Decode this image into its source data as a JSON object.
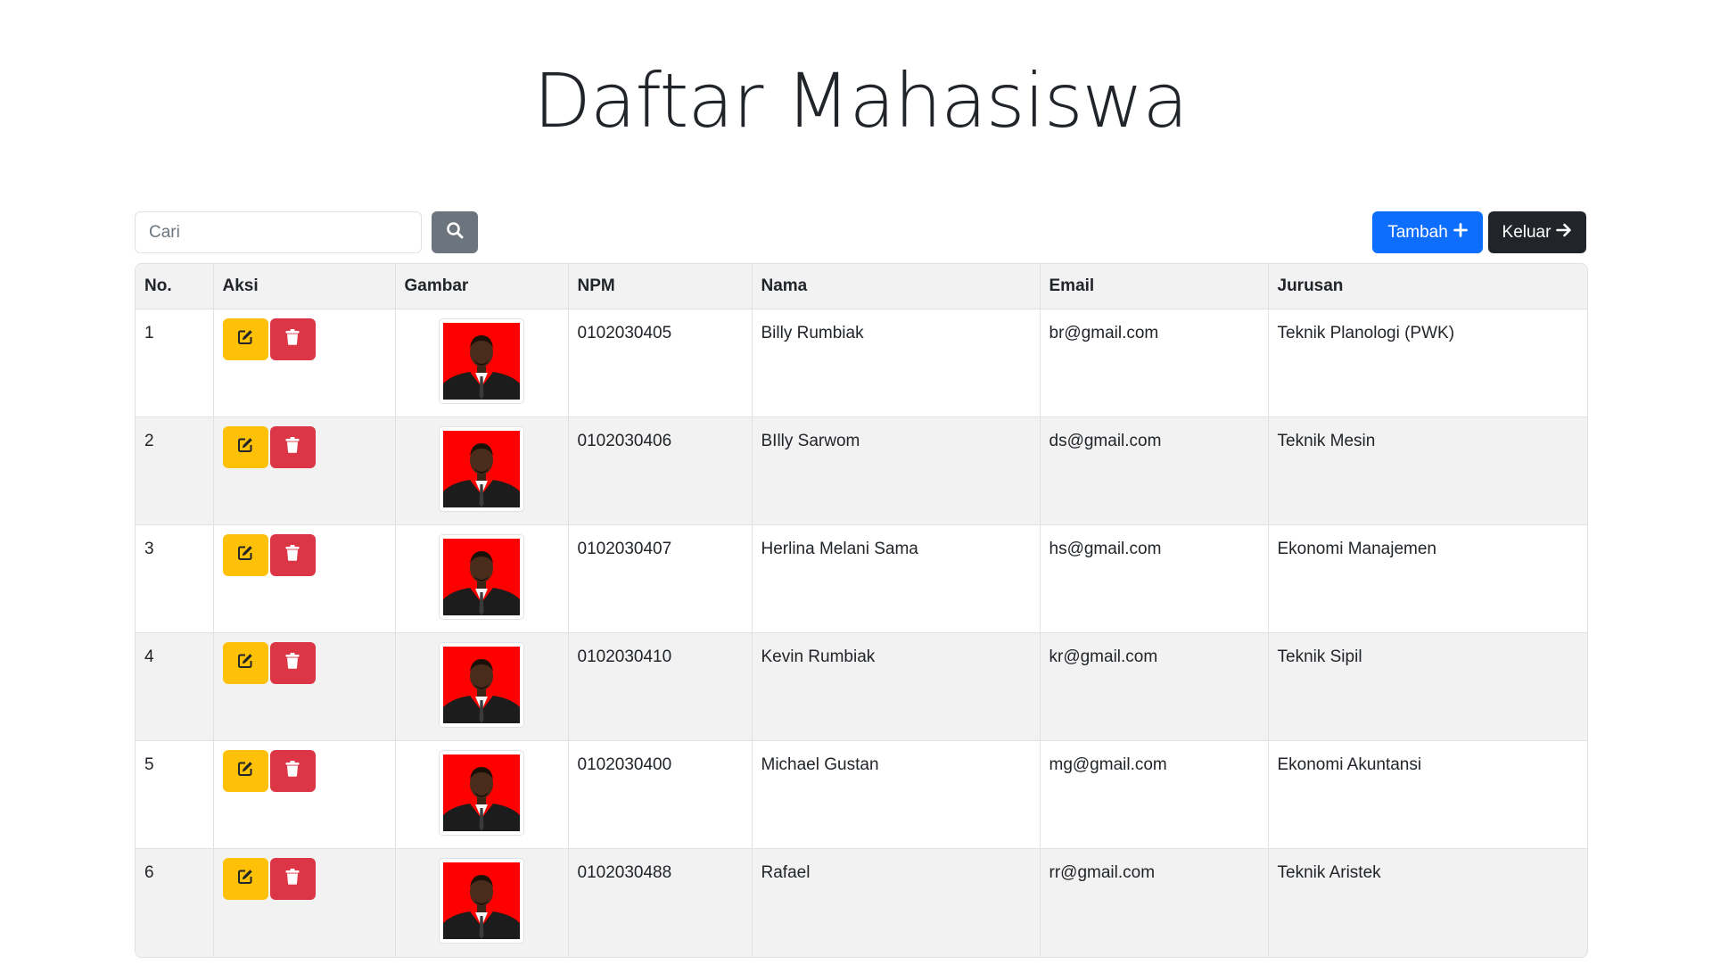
{
  "page": {
    "title": "Daftar Mahasiswa"
  },
  "search": {
    "placeholder": "Cari",
    "button_icon": "search-icon"
  },
  "actions": {
    "add_label": "Tambah",
    "add_icon": "plus-icon",
    "exit_label": "Keluar",
    "exit_icon": "arrow-right-icon"
  },
  "table": {
    "headers": [
      "No.",
      "Aksi",
      "Gambar",
      "NPM",
      "Nama",
      "Email",
      "Jurusan"
    ],
    "rows": [
      {
        "no": "1",
        "npm": "0102030405",
        "nama": "Billy Rumbiak",
        "email": "br@gmail.com",
        "jurusan": "Teknik Planologi (PWK)"
      },
      {
        "no": "2",
        "npm": "0102030406",
        "nama": "BIlly Sarwom",
        "email": "ds@gmail.com",
        "jurusan": "Teknik Mesin"
      },
      {
        "no": "3",
        "npm": "0102030407",
        "nama": "Herlina Melani Sama",
        "email": "hs@gmail.com",
        "jurusan": "Ekonomi Manajemen"
      },
      {
        "no": "4",
        "npm": "0102030410",
        "nama": "Kevin Rumbiak",
        "email": "kr@gmail.com",
        "jurusan": "Teknik Sipil"
      },
      {
        "no": "5",
        "npm": "0102030400",
        "nama": "Michael Gustan",
        "email": "mg@gmail.com",
        "jurusan": "Ekonomi Akuntansi"
      },
      {
        "no": "6",
        "npm": "0102030488",
        "nama": "Rafael",
        "email": "rr@gmail.com",
        "jurusan": "Teknik Aristek"
      }
    ]
  },
  "colors": {
    "primary": "#0d6efd",
    "dark": "#212529",
    "secondary": "#6c757d",
    "warning": "#ffc107",
    "danger": "#dc3545",
    "photo_background": "#ff0000"
  }
}
